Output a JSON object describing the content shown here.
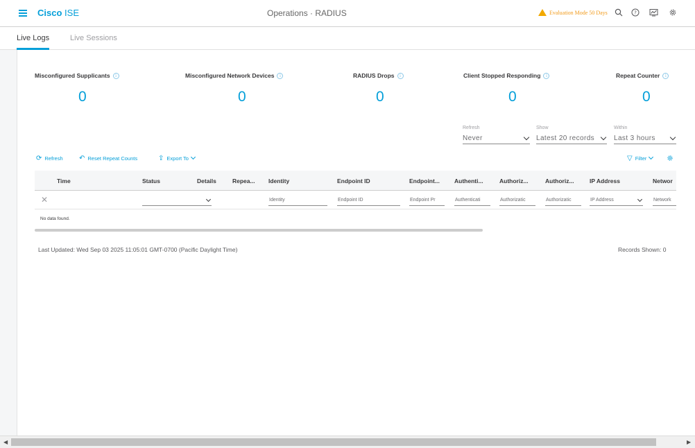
{
  "header": {
    "brand": "Cisco",
    "product": "ISE",
    "title": "Operations · RADIUS",
    "evaluation": "Evaluation Mode 50 Days"
  },
  "tabs": [
    {
      "label": "Live Logs",
      "active": true
    },
    {
      "label": "Live Sessions",
      "active": false
    }
  ],
  "metrics": [
    {
      "label": "Misconfigured Supplicants",
      "value": "0"
    },
    {
      "label": "Misconfigured Network Devices",
      "value": "0"
    },
    {
      "label": "RADIUS Drops",
      "value": "0"
    },
    {
      "label": "Client Stopped Responding",
      "value": "0"
    },
    {
      "label": "Repeat Counter",
      "value": "0"
    }
  ],
  "filters": {
    "refresh": {
      "label": "Refresh",
      "value": "Never"
    },
    "show": {
      "label": "Show",
      "value": "Latest 20 records"
    },
    "within": {
      "label": "Within",
      "value": "Last 3 hours"
    }
  },
  "toolbar": {
    "refresh": "Refresh",
    "reset": "Reset Repeat Counts",
    "export": "Export To",
    "filter": "Filter"
  },
  "table": {
    "columns": [
      "Time",
      "Status",
      "Details",
      "Repea...",
      "Identity",
      "Endpoint ID",
      "Endpoint...",
      "Authenti...",
      "Authoriz...",
      "Authoriz...",
      "IP Address",
      "Networ"
    ],
    "filter_placeholders": [
      "Identity",
      "Endpoint ID",
      "Endpoint Pr",
      "Authenticati",
      "Authorizatic",
      "Authorizatic",
      "IP Address",
      "Network"
    ],
    "empty": "No data found."
  },
  "footer": {
    "last_updated": "Last Updated: Wed Sep 03 2025 11:05:01 GMT-0700 (Pacific Daylight Time)",
    "records_shown": "Records Shown: 0"
  },
  "colors": {
    "accent": "#049fd9",
    "warning": "#f2a900"
  }
}
